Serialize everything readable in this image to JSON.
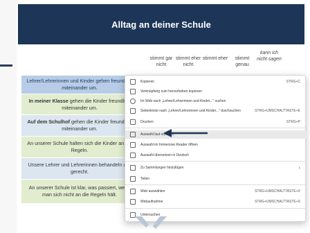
{
  "banner": {
    "title": "Alltag an deiner Schule"
  },
  "columns": [
    "stimmt gar nicht",
    "stimmt eher nicht",
    "stimmt eher",
    "stimmt genau",
    "kann ich nicht sagen"
  ],
  "rows": [
    {
      "bold": "",
      "text": "Lehrer/Lehrerinnen und Kinder gehen freundlich miteinander um."
    },
    {
      "bold": "In meiner Klasse",
      "text": " gehen die Kinder freundlich miteinander um."
    },
    {
      "bold": "Auf dem Schulhof",
      "text": " gehen die Kinder freundlich miteinander um."
    },
    {
      "bold": "",
      "text": "An unserer Schule halten sich die Kinder an die Regeln."
    },
    {
      "bold": "",
      "text": "Unsere Lehrer und Lehrerinnen behandeln alle gerecht."
    },
    {
      "bold": "",
      "text": "An unserer Schule ist klar, was passiert, wenn man sich nicht an die Regeln hält."
    }
  ],
  "context_menu": {
    "items": [
      {
        "label": "Kopieren",
        "shortcut": "STRG+C"
      },
      {
        "label": "Verknüpfung zum hervorheben kopieren",
        "shortcut": ""
      },
      {
        "label": "Im Web nach „Lehrer/Lehrerinnen und Kinder...“ suchen",
        "shortcut": ""
      },
      {
        "label": "Seitenleiste nach „Lehrer/Lehrerinnen und Kinder...“ durchsuchen",
        "shortcut": "STRG+UMSCHALTTASTE+E"
      },
      {
        "label": "Drucken",
        "shortcut": "STRG+P"
      },
      {
        "label": "Auswahl laut vorlesen",
        "shortcut": ""
      },
      {
        "label": "Auswahl im Immersive Reader öffnen",
        "shortcut": ""
      },
      {
        "label": "Auswahl übersetzen in Deutsch",
        "shortcut": ""
      },
      {
        "label": "Zu Sammlungen hinzufügen",
        "shortcut": ""
      },
      {
        "label": "Teilen",
        "shortcut": ""
      },
      {
        "label": "Web auswählen",
        "shortcut": "STRG+UMSCHALTTASTE+X"
      },
      {
        "label": "Webaufnahme",
        "shortcut": "STRG+UMSCHALTTASTE+S"
      },
      {
        "label": "Untersuchen",
        "shortcut": ""
      }
    ],
    "highlighted_index": 5
  },
  "colors": {
    "banner": "#1d3557",
    "row_blue": "#dbe6f1",
    "row_green": "#e2edcf",
    "selection": "#b7cce6",
    "arrow": "#1d3557"
  }
}
